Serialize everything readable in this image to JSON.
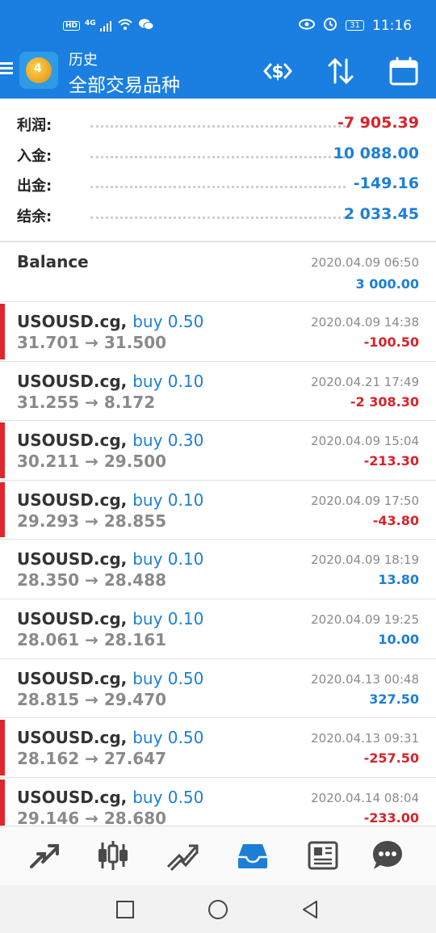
{
  "status_bar": {
    "hd_label": "HD",
    "network": "4G",
    "battery": "31",
    "time": "11:16"
  },
  "app_bar": {
    "subtitle": "历史",
    "title": "全部交易品种",
    "icons": [
      "menu-icon",
      "metatrader-logo",
      "dollar-exchange-icon",
      "sort-icon",
      "calendar-icon"
    ]
  },
  "summary": [
    {
      "label": "利润:",
      "value": "-7 905.39",
      "color": "red"
    },
    {
      "label": "入金:",
      "value": "10 088.00",
      "color": "blue"
    },
    {
      "label": "出金:",
      "value": "-149.16",
      "color": "blue"
    },
    {
      "label": "结余:",
      "value": "2 033.45",
      "color": "blue"
    }
  ],
  "balance": {
    "title": "Balance",
    "time": "2020.04.09 06:50",
    "amount": "3 000.00"
  },
  "trades": [
    {
      "symbol": "USOUSD.cg,",
      "action": "buy 0.50",
      "prices": "31.701 → 31.500",
      "time": "2020.04.09 14:38",
      "pl": "-100.50",
      "loss": true,
      "marked": true
    },
    {
      "symbol": "USOUSD.cg,",
      "action": "buy 0.10",
      "prices": "31.255 → 8.172",
      "time": "2020.04.21 17:49",
      "pl": "-2 308.30",
      "loss": true,
      "marked": false
    },
    {
      "symbol": "USOUSD.cg,",
      "action": "buy 0.30",
      "prices": "30.211 → 29.500",
      "time": "2020.04.09 15:04",
      "pl": "-213.30",
      "loss": true,
      "marked": true
    },
    {
      "symbol": "USOUSD.cg,",
      "action": "buy 0.10",
      "prices": "29.293 → 28.855",
      "time": "2020.04.09 17:50",
      "pl": "-43.80",
      "loss": true,
      "marked": true
    },
    {
      "symbol": "USOUSD.cg,",
      "action": "buy 0.10",
      "prices": "28.350 → 28.488",
      "time": "2020.04.09 18:19",
      "pl": "13.80",
      "loss": false,
      "marked": false
    },
    {
      "symbol": "USOUSD.cg,",
      "action": "buy 0.10",
      "prices": "28.061 → 28.161",
      "time": "2020.04.09 19:25",
      "pl": "10.00",
      "loss": false,
      "marked": false
    },
    {
      "symbol": "USOUSD.cg,",
      "action": "buy 0.50",
      "prices": "28.815 → 29.470",
      "time": "2020.04.13 00:48",
      "pl": "327.50",
      "loss": false,
      "marked": false
    },
    {
      "symbol": "USOUSD.cg,",
      "action": "buy 0.50",
      "prices": "28.162 → 27.647",
      "time": "2020.04.13 09:31",
      "pl": "-257.50",
      "loss": true,
      "marked": true
    },
    {
      "symbol": "USOUSD.cg,",
      "action": "buy 0.50",
      "prices": "29.146 → 28.680",
      "time": "2020.04.14 08:04",
      "pl": "-233.00",
      "loss": true,
      "marked": true
    }
  ],
  "tabs": [
    {
      "name": "tab-quotes",
      "icon": "arrows-icon"
    },
    {
      "name": "tab-charts",
      "icon": "candlestick-icon"
    },
    {
      "name": "tab-trade",
      "icon": "trend-icon"
    },
    {
      "name": "tab-history",
      "icon": "inbox-icon",
      "active": true
    },
    {
      "name": "tab-news",
      "icon": "newspaper-icon"
    },
    {
      "name": "tab-chat",
      "icon": "chat-icon"
    }
  ],
  "colors": {
    "primary": "#1a7fe0",
    "loss": "#d8232a",
    "profit": "#1c7fd6",
    "active_tab": "#1c7fd6",
    "inactive_tab": "#4a4a4a"
  }
}
